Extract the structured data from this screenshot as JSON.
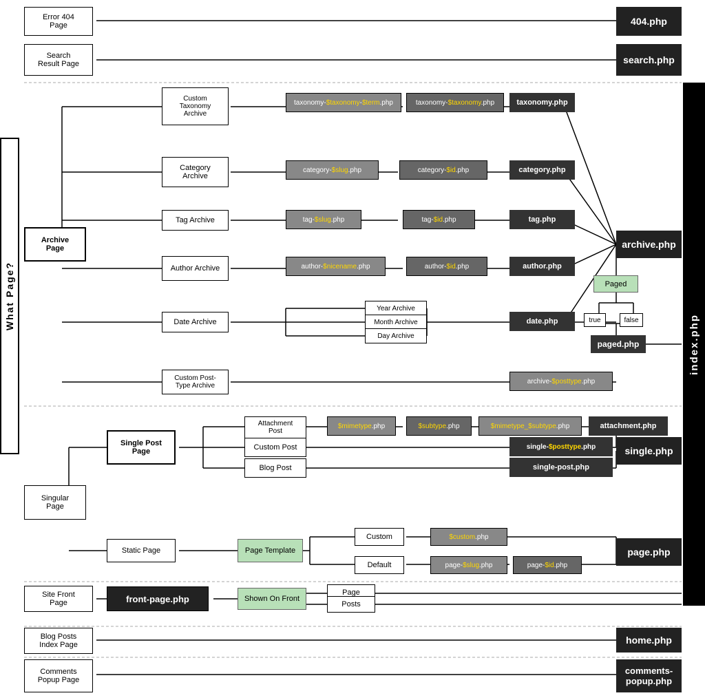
{
  "sidebar": {
    "what_page": "What Page?",
    "index_php": "index.php"
  },
  "sections": {
    "error404": {
      "label": "Error 404\nPage",
      "file": "404.php"
    },
    "search": {
      "label": "Search\nResult Page",
      "file": "search.php"
    },
    "archive": {
      "label": "Archive\nPage",
      "file": "archive.php",
      "children": {
        "custom_taxonomy": {
          "label": "Custom\nTaxonomy\nArchive"
        },
        "category": {
          "label": "Category\nArchive"
        },
        "tag": {
          "label": "Tag Archive"
        },
        "author": {
          "label": "Author Archive"
        },
        "date": {
          "label": "Date Archive",
          "children": [
            "Year Archive",
            "Month Archive",
            "Day Archive"
          ],
          "file": "date.php"
        },
        "custom_post_type": {
          "label": "Custom Post-\nType Archive"
        }
      },
      "paged": {
        "label": "Paged",
        "true": "true",
        "false": "false",
        "file": "paged.php"
      }
    },
    "singular": {
      "label": "Singular\nPage",
      "children": {
        "single_post": {
          "label": "Single Post\nPage",
          "file": "single.php",
          "children": {
            "attachment": {
              "label": "Attachment\nPost"
            },
            "custom_post": {
              "label": "Custom Post"
            },
            "blog_post": {
              "label": "Blog Post"
            }
          }
        },
        "static_page": {
          "label": "Static Page",
          "template": "Page Template",
          "custom": "Custom",
          "default": "Default",
          "file": "page.php"
        }
      }
    },
    "site_front": {
      "label": "Site Front\nPage",
      "file": "front-page.php",
      "shown_on_front": "Shown On Front",
      "page": "Page",
      "posts": "Posts"
    },
    "blog_posts": {
      "label": "Blog Posts\nIndex Page",
      "file": "home.php"
    },
    "comments_popup": {
      "label": "Comments\nPopup Page",
      "file": "comments-popup.php"
    }
  },
  "template_files": {
    "taxonomy_term": "taxonomy-$taxonomy-$term.php",
    "taxonomy": "taxonomy-$taxonomy.php",
    "taxonomy_fallback": "taxonomy.php",
    "category_slug": "category-$slug.php",
    "category_id": "category-$id.php",
    "category_fallback": "category.php",
    "tag_slug": "tag-$slug.php",
    "tag_id": "tag-$id.php",
    "tag_fallback": "tag.php",
    "author_nicename": "author-$nicename.php",
    "author_id": "author-$id.php",
    "author_fallback": "author.php",
    "date_fallback": "date.php",
    "custom_post_type_archive": "archive-$posttype.php",
    "mimetype": "$mimetype.php",
    "subtype": "$subtype.php",
    "mimetype_subtype": "$mimetype_subtype.php",
    "attachment_fallback": "attachment.php",
    "single_posttype": "single-$posttype.php",
    "single_post_fallback": "single-post.php",
    "custom_template": "$custom.php",
    "page_slug": "page-$slug.php",
    "page_id": "page-$id.php",
    "page_fallback": "page.php"
  }
}
